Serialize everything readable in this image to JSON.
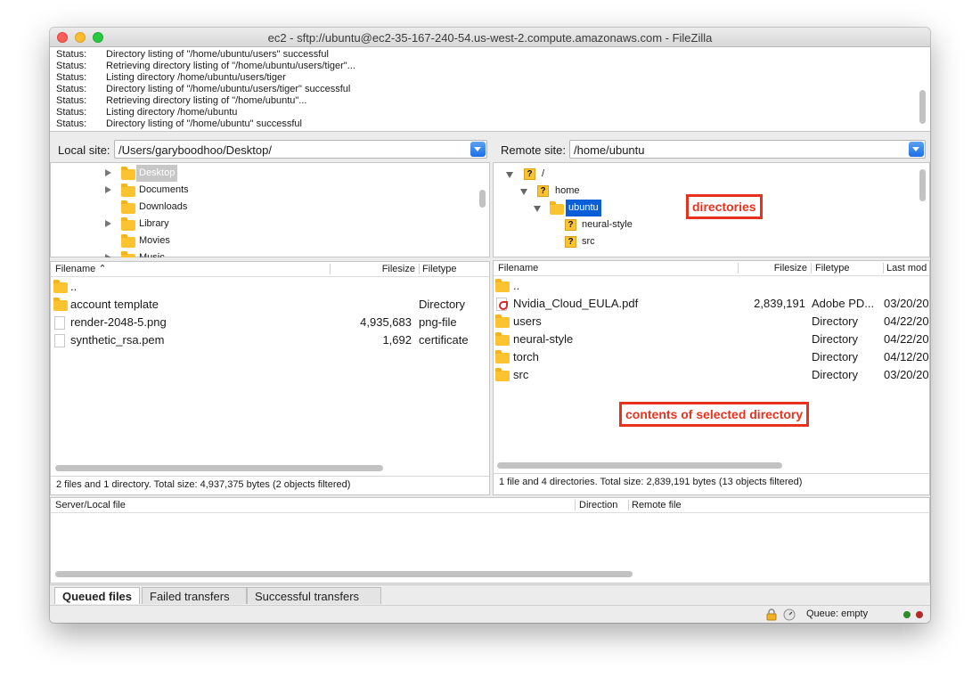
{
  "window": {
    "title": "ec2 - sftp://ubuntu@ec2-35-167-240-54.us-west-2.compute.amazonaws.com - FileZilla"
  },
  "log": [
    {
      "label": "Status:",
      "message": "Directory listing of \"/home/ubuntu/users\" successful"
    },
    {
      "label": "Status:",
      "message": "Retrieving directory listing of \"/home/ubuntu/users/tiger\"..."
    },
    {
      "label": "Status:",
      "message": "Listing directory /home/ubuntu/users/tiger"
    },
    {
      "label": "Status:",
      "message": "Directory listing of \"/home/ubuntu/users/tiger\" successful"
    },
    {
      "label": "Status:",
      "message": "Retrieving directory listing of \"/home/ubuntu\"..."
    },
    {
      "label": "Status:",
      "message": "Listing directory /home/ubuntu"
    },
    {
      "label": "Status:",
      "message": "Directory listing of \"/home/ubuntu\" successful"
    }
  ],
  "local": {
    "site_label": "Local site:",
    "path": "/Users/garyboodhoo/Desktop/",
    "tree": [
      {
        "name": "Desktop",
        "selected": true,
        "expandable": true
      },
      {
        "name": "Documents",
        "expandable": true
      },
      {
        "name": "Downloads",
        "expandable": false
      },
      {
        "name": "Library",
        "expandable": true
      },
      {
        "name": "Movies",
        "expandable": false
      },
      {
        "name": "Music",
        "expandable": true
      }
    ],
    "headers": {
      "filename": "Filename",
      "filesize": "Filesize",
      "filetype": "Filetype"
    },
    "files": [
      {
        "name": "..",
        "size": "",
        "type": "",
        "icon": "folder-icon"
      },
      {
        "name": "account template",
        "size": "",
        "type": "Directory",
        "icon": "folder-icon"
      },
      {
        "name": "render-2048-5.png",
        "size": "4,935,683",
        "type": "png-file",
        "icon": "file-icon"
      },
      {
        "name": "synthetic_rsa.pem",
        "size": "1,692",
        "type": "certificate",
        "icon": "file-icon"
      }
    ],
    "status": "2 files and 1 directory. Total size: 4,937,375 bytes (2 objects filtered)"
  },
  "remote": {
    "site_label": "Remote site:",
    "path": "/home/ubuntu",
    "tree": [
      {
        "name": "/",
        "icon": "unknown-icon",
        "expanded": true
      },
      {
        "name": "home",
        "icon": "unknown-icon",
        "expanded": true
      },
      {
        "name": "ubuntu",
        "icon": "folder-icon",
        "expanded": true,
        "selected": true
      },
      {
        "name": "neural-style",
        "icon": "unknown-icon"
      },
      {
        "name": "src",
        "icon": "unknown-icon"
      }
    ],
    "headers": {
      "filename": "Filename",
      "filesize": "Filesize",
      "filetype": "Filetype",
      "lastmod": "Last mod"
    },
    "files": [
      {
        "name": "..",
        "size": "",
        "type": "",
        "modified": "",
        "icon": "folder-icon"
      },
      {
        "name": "Nvidia_Cloud_EULA.pdf",
        "size": "2,839,191",
        "type": "Adobe PD...",
        "modified": "03/20/20",
        "icon": "pdf-icon"
      },
      {
        "name": "users",
        "size": "",
        "type": "Directory",
        "modified": "04/22/20",
        "icon": "folder-icon"
      },
      {
        "name": "neural-style",
        "size": "",
        "type": "Directory",
        "modified": "04/22/20",
        "icon": "folder-icon"
      },
      {
        "name": "torch",
        "size": "",
        "type": "Directory",
        "modified": "04/12/20",
        "icon": "folder-icon"
      },
      {
        "name": "src",
        "size": "",
        "type": "Directory",
        "modified": "03/20/20",
        "icon": "folder-icon"
      }
    ],
    "status": "1 file and 4 directories. Total size: 2,839,191 bytes (13 objects filtered)"
  },
  "annotations": {
    "directories": "directories",
    "contents": "contents of selected directory"
  },
  "queue": {
    "headers": {
      "server_local": "Server/Local file",
      "direction": "Direction",
      "remote": "Remote file"
    },
    "tabs": [
      "Queued files",
      "Failed transfers",
      "Successful transfers"
    ],
    "status": "Queue: empty"
  },
  "colors": {
    "accent": "#0a5fd9",
    "annotation": "#e8321e",
    "folder": "#fbc32f"
  }
}
